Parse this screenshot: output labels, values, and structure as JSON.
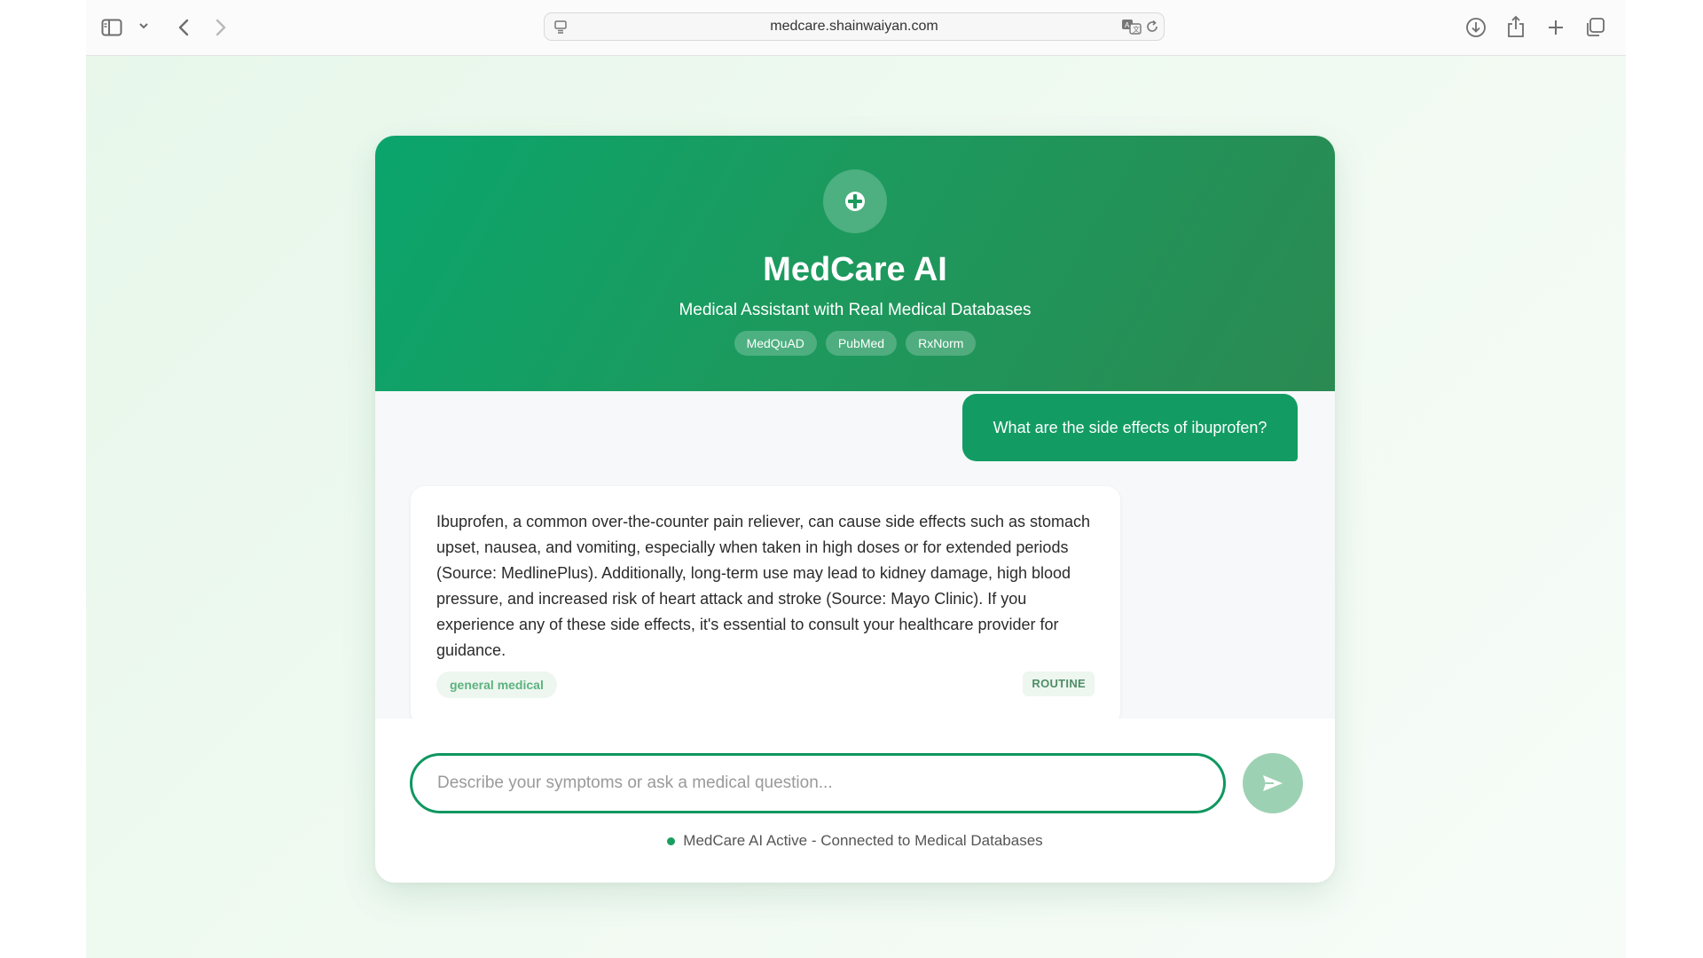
{
  "browser": {
    "url": "medcare.shainwaiyan.com",
    "icons": [
      "sidebar-icon",
      "chevron-down-icon",
      "back-icon",
      "forward-icon",
      "page-settings-icon",
      "translate-icon",
      "reload-icon",
      "download-icon",
      "share-icon",
      "new-tab-icon",
      "tabs-overview-icon"
    ]
  },
  "header": {
    "logo_icon": "medical-cross-icon",
    "title": "MedCare AI",
    "subtitle": "Medical Assistant with Real Medical Databases",
    "tags": [
      "MedQuAD",
      "PubMed",
      "RxNorm"
    ]
  },
  "chat": {
    "user_message": "What are the side effects of ibuprofen?",
    "assistant_message": "Ibuprofen, a common over-the-counter pain reliever, can cause side effects such as stomach upset, nausea, and vomiting, especially when taken in high doses or for extended periods (Source: MedlinePlus). Additionally, long-term use may lead to kidney damage, high blood pressure, and increased risk of heart attack and stroke (Source: Mayo Clinic). If you experience any of these side effects, it's essential to consult your healthcare provider for guidance.",
    "category": "general medical",
    "urgency": "ROUTINE"
  },
  "input": {
    "placeholder": "Describe your symptoms or ask a medical question...",
    "value": "",
    "send_icon": "send-icon"
  },
  "status": {
    "text": "MedCare AI Active - Connected to Medical Databases"
  },
  "colors": {
    "brand_green": "#129c63",
    "header_gradient_start": "#0aa56c",
    "header_gradient_end": "#2a8a52",
    "send_button": "#9dd1b3",
    "status_dot": "#1a9e5e"
  }
}
